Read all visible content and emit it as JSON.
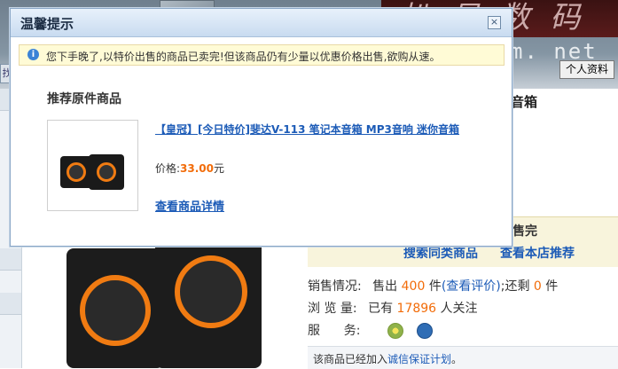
{
  "background": {
    "logo_script": "扒 易 数 码",
    "domain_text": "m. net",
    "profile_button": "个人资料",
    "left_tab": "找",
    "product_title": "音箱",
    "soldout_text": "售完",
    "search_similar_link": "搜索同类商品",
    "shop_recommend_link": "查看本店推荐",
    "sales": {
      "label": "销售情况:",
      "sold_prefix": "售出",
      "sold_count": "400",
      "sold_unit": "件",
      "review_link": "(查看评价)",
      "remaining_prefix": ";还剩",
      "remaining_count": "0",
      "remaining_unit": "件"
    },
    "views": {
      "label": "浏 览 量:",
      "prefix": "已有",
      "count": "17896",
      "suffix": "人关注"
    },
    "service": {
      "label": "服      务:",
      "icons": [
        "guarantee-icon",
        "shield-icon"
      ]
    },
    "bottom": {
      "prefix": "该商品已经加入",
      "link": "诚信保证计划",
      "suffix": "。"
    }
  },
  "dialog": {
    "title": "温馨提示",
    "close_label": "×",
    "notice_icon": "i",
    "notice_text": "您下手晚了,以特价出售的商品已卖完!但该商品仍有少量以优惠价格出售,欲购从速。",
    "rec_heading": "推荐原件商品",
    "product": {
      "name": "【皇冠】[今日特价]斐达V-113 笔记本音箱 MP3音响 迷你音箱",
      "price_label": "价格:",
      "price_value": "33.00",
      "price_unit": "元",
      "detail_link": "查看商品详情"
    }
  },
  "colors": {
    "link": "#1c5bb7",
    "price": "#f26c09",
    "notice_bg": "#fffbd6",
    "titlebar": "#c8dbf0"
  }
}
